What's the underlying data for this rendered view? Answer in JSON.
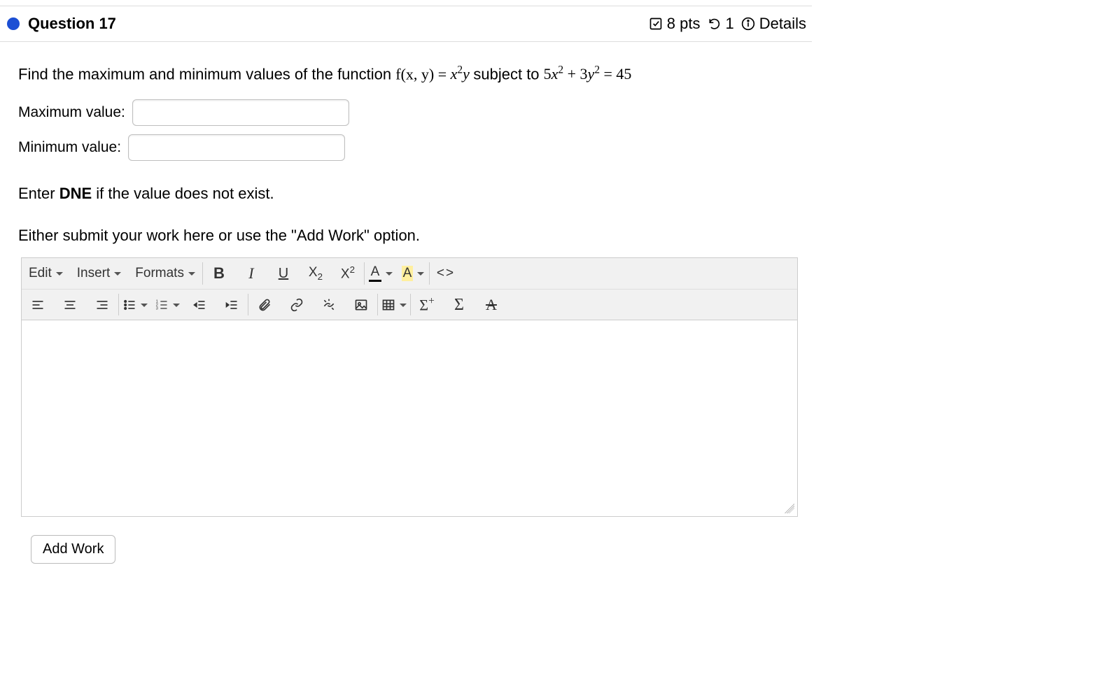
{
  "header": {
    "title": "Question 17",
    "points": "8 pts",
    "attempts": "1",
    "details_label": "Details"
  },
  "question": {
    "prompt_prefix": "Find the maximum and minimum values of the function ",
    "func_lhs": "f(x, y) = ",
    "func_rhs_html": "x²y",
    "subject_text": " subject to ",
    "constraint_html": "5x² + 3y² = 45"
  },
  "inputs": {
    "max_label": "Maximum value:",
    "min_label": "Minimum value:",
    "max_value": "",
    "min_value": ""
  },
  "notes": {
    "dne_prefix": "Enter ",
    "dne_word": "DNE",
    "dne_suffix": " if the value does not exist.",
    "submit_note": "Either submit your work here or use the \"Add Work\" option."
  },
  "toolbar": {
    "menus": {
      "edit": "Edit",
      "insert": "Insert",
      "formats": "Formats"
    },
    "row1": {
      "bold": "B",
      "italic": "I",
      "underline": "U",
      "subscript": "X",
      "superscript": "X",
      "textcolor": "A",
      "highlight": "A",
      "code": "‹›"
    },
    "row2": {
      "sigma_plus": "Σ⁺",
      "sigma": "Σ",
      "strike_a": "A"
    }
  },
  "buttons": {
    "add_work": "Add Work"
  }
}
